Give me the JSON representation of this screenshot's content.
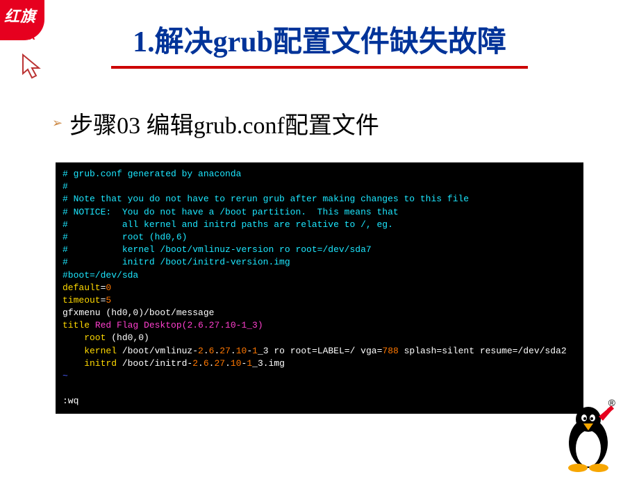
{
  "logo": {
    "line1": "红旗",
    "line2": "Linux"
  },
  "title": "1.解决grub配置文件缺失故障",
  "step": {
    "label": "步骤03 编辑grub.conf配置文件"
  },
  "terminal": {
    "l1": "# grub.conf generated by anaconda",
    "l2": "#",
    "l3": "# Note that you do not have to rerun grub after making changes to this file",
    "l4": "# NOTICE:  You do not have a /boot partition.  This means that",
    "l5": "#          all kernel and initrd paths are relative to /, eg.",
    "l6": "#          root (hd0,6)",
    "l7": "#          kernel /boot/vmlinuz-version ro root=/dev/sda7",
    "l8": "#          initrd /boot/initrd-version.img",
    "l9": "#boot=/dev/sda",
    "l10_k": "default",
    "l10_e": "=",
    "l10_v": "0",
    "l11_k": "timeout",
    "l11_e": "=",
    "l11_v": "5",
    "l12": "gfxmenu (hd0,0)/boot/message",
    "l13_k": "title",
    "l13_v": " Red Flag Desktop(2.6.27.10-1_3)",
    "l14_k": "    root",
    "l14_v": " (hd0,0)",
    "l15_k": "    kernel",
    "l15a": " /boot/vmlinuz-",
    "l15b": "2",
    "l15c": ".",
    "l15d": "6",
    "l15e": ".",
    "l15f": "27",
    "l15g": ".",
    "l15h": "10",
    "l15i": "-",
    "l15j": "1",
    "l15k": "_3 ro root=LABEL=/ vga=",
    "l15l": "788",
    "l15m": " splash=silent resume=/dev/sda2",
    "l16_k": "    initrd",
    "l16a": " /boot/initrd-",
    "l16b": "2",
    "l16c": ".",
    "l16d": "6",
    "l16e": ".",
    "l16f": "27",
    "l16g": ".",
    "l16h": "10",
    "l16i": "-",
    "l16j": "1",
    "l16k": "_3.img",
    "tilde": "~",
    "cmd": ":wq"
  },
  "registered": "®"
}
